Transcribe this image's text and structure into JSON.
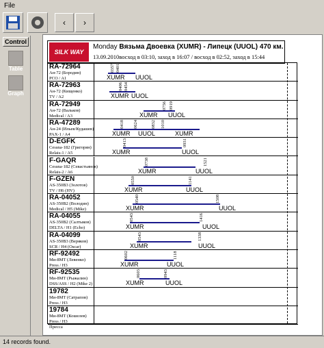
{
  "menu": {
    "file": "File"
  },
  "sidebar": {
    "control": "Control",
    "table": "Table",
    "graph": "Graph"
  },
  "nav": {
    "prev": "‹",
    "next": "›"
  },
  "header": {
    "logo": "SILK WAY",
    "day": "Monday",
    "route": "Вязьма Двоевка (XUMR) - Липецк (UUOL) 470 км.",
    "date_line": "13.09.2010восход в 03:10, заход в 16:07 / восход в 02:52, заход в 15:44"
  },
  "rows": [
    {
      "reg": "RA-72964",
      "type": "Ан-72 (Бородин)",
      "role": "PCO / A1",
      "dep": "XUMR",
      "arr": "UUOL",
      "t1": "0357",
      "t2": "0401"
    },
    {
      "reg": "RA-72963",
      "type": "Ан-72 (Кищенко)",
      "role": "TV / A2",
      "dep": "XUMR",
      "arr": "UUOL",
      "t1": "0406",
      "t2": "0454"
    },
    {
      "reg": "RA-72949",
      "type": "Ан-72 (Вальков)",
      "role": "Medical / A3",
      "dep": "XUMR",
      "arr": "UUOL",
      "t1": "0756",
      "t2": "0919"
    },
    {
      "reg": "RA-47289",
      "type": "Ан-24 (Ильев/Кудашев)",
      "role": "PAX-1 / A4",
      "dep": "XUMR",
      "arr": "UUOL",
      "t1": "0418",
      "t2": "0624",
      "t3": "0832",
      "t4": "1010",
      "mid": "XUMR"
    },
    {
      "reg": "D-EGFK",
      "type": "Cessna-182 (Григорян)",
      "role": "Relais-1 / A5",
      "dep": "XUMR",
      "arr": "UUOL",
      "t1": "0413",
      "t2": "0931"
    },
    {
      "reg": "F-GAQR",
      "type": "Cessna-182 (Севастьянов)",
      "role": "Relais-2 / A6",
      "dep": "XUMR",
      "arr": "UUOL",
      "t1": "0738",
      "t2": "1521"
    },
    {
      "reg": "F-GZEN",
      "type": "AS-350B3 (Золотов)",
      "role": "TV / H6 (HV)",
      "dep": "XUMR",
      "arr": "UUOL",
      "t1": "0550",
      "t2": "1141"
    },
    {
      "reg": "RA-04052",
      "type": "AS-350B2 (Володин)",
      "role": "Medical / H5 (Mike)",
      "dep": "XUMR",
      "arr": "UUOL",
      "t1": "0540",
      "t2": "1508"
    },
    {
      "reg": "RA-04055",
      "type": "AS-350B2 (Салтыков)",
      "role": "DELTA / H1 (Echo)",
      "dep": "XUMR",
      "arr": "UUOL",
      "t1": "0543",
      "t2": "1416"
    },
    {
      "reg": "RA-04099",
      "type": "AS-350B3 (Веряков)",
      "role": "SCR / H4 (Oscar)",
      "dep": "XUMR",
      "arr": "UUOL",
      "t1": "0543",
      "t2": "1338"
    },
    {
      "reg": "RF-92492",
      "type": "Ми-8МТ (Левенко)",
      "role": "Press / H3",
      "dep": "XUMR",
      "arr": "UUOL",
      "t1": "0602",
      "t2": "1118"
    },
    {
      "reg": "RF-92535",
      "type": "Ми-8МТ (Рыжалин)",
      "role": "DSS/ASS / H2 (Mike 2)",
      "dep": "XUMR",
      "arr": "UUOL",
      "t1": "0603",
      "t2": "0943"
    },
    {
      "reg": "19782",
      "type": "Ми-8МТ (Сатрапов)",
      "role": "Press / H3",
      "dep": "",
      "arr": "",
      "t1": "",
      "t2": ""
    },
    {
      "reg": "19784",
      "type": "Ми-8МТ (Кошелев)",
      "role": "Press / H3",
      "extra": "Пресса",
      "dep": "",
      "arr": "",
      "t1": "",
      "t2": ""
    }
  ],
  "status": "14 records found."
}
